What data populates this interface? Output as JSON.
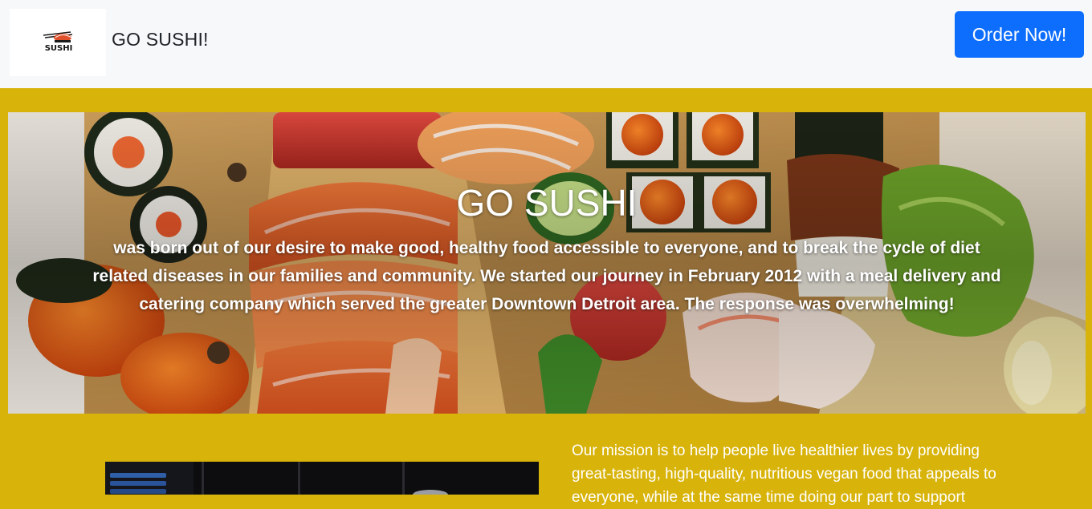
{
  "navbar": {
    "logo_text": "SUSHI",
    "brand": "GO SUSHI!",
    "order_button": "Order Now!"
  },
  "hero": {
    "title": "GO SUSHI",
    "text": "was born out of our desire to make good, healthy food accessible to everyone, and to break the cycle of diet related diseases in our families and community. We started our journey in February 2012 with a meal delivery and catering company which served the greater Downtown Detroit area. The response was overwhelming!"
  },
  "about": {
    "mission": "Our mission is to help people live healthier lives by providing great-tasting, high-quality, nutritious vegan food that appeals to everyone, while at the same time doing our part to support"
  },
  "colors": {
    "page_background": "#d8b30a",
    "navbar_background": "#f6f8fa",
    "button_primary": "#0d6efd"
  }
}
